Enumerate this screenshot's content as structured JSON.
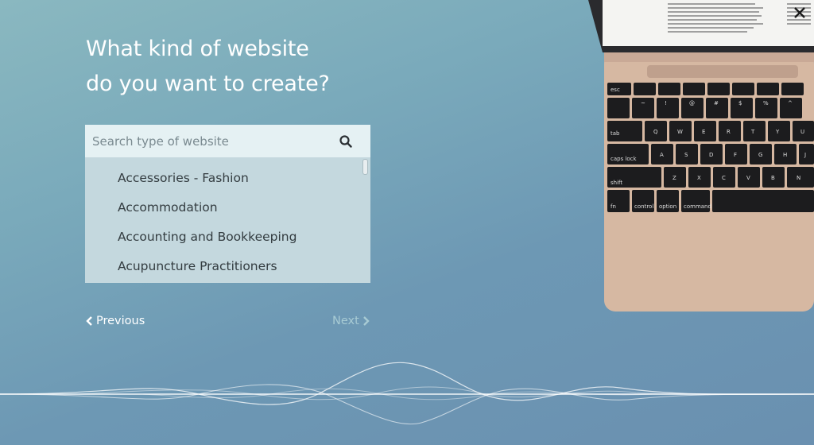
{
  "heading": {
    "line1": "What kind of website",
    "line2": "do you want to create?"
  },
  "search": {
    "placeholder": "Search type of website",
    "icon": "search-icon"
  },
  "options": [
    {
      "label": "Accessories - Fashion"
    },
    {
      "label": "Accommodation"
    },
    {
      "label": "Accounting and Bookkeeping"
    },
    {
      "label": "Acupuncture Practitioners"
    }
  ],
  "nav": {
    "previous_label": "Previous",
    "next_label": "Next"
  },
  "close": {
    "icon": "close-icon"
  },
  "keyboard": {
    "row1": [
      "esc",
      "",
      "",
      "",
      "",
      "",
      "",
      ""
    ],
    "row2": [
      "~",
      "!",
      "@",
      "#",
      "$",
      "%",
      "^",
      "&"
    ],
    "row3": [
      "tab",
      "Q",
      "W",
      "E",
      "R",
      "T",
      "Y",
      "U"
    ],
    "row4": [
      "caps lock",
      "A",
      "S",
      "D",
      "F",
      "G",
      "H",
      "J"
    ],
    "row5": [
      "shift",
      "Z",
      "X",
      "C",
      "V",
      "B",
      "N"
    ],
    "row6": [
      "fn",
      "control",
      "option",
      "command"
    ]
  },
  "colors": {
    "accent_text": "#ffffff",
    "disabled_text": "#a8cbd4",
    "laptop_body": "#d7b9a4"
  }
}
